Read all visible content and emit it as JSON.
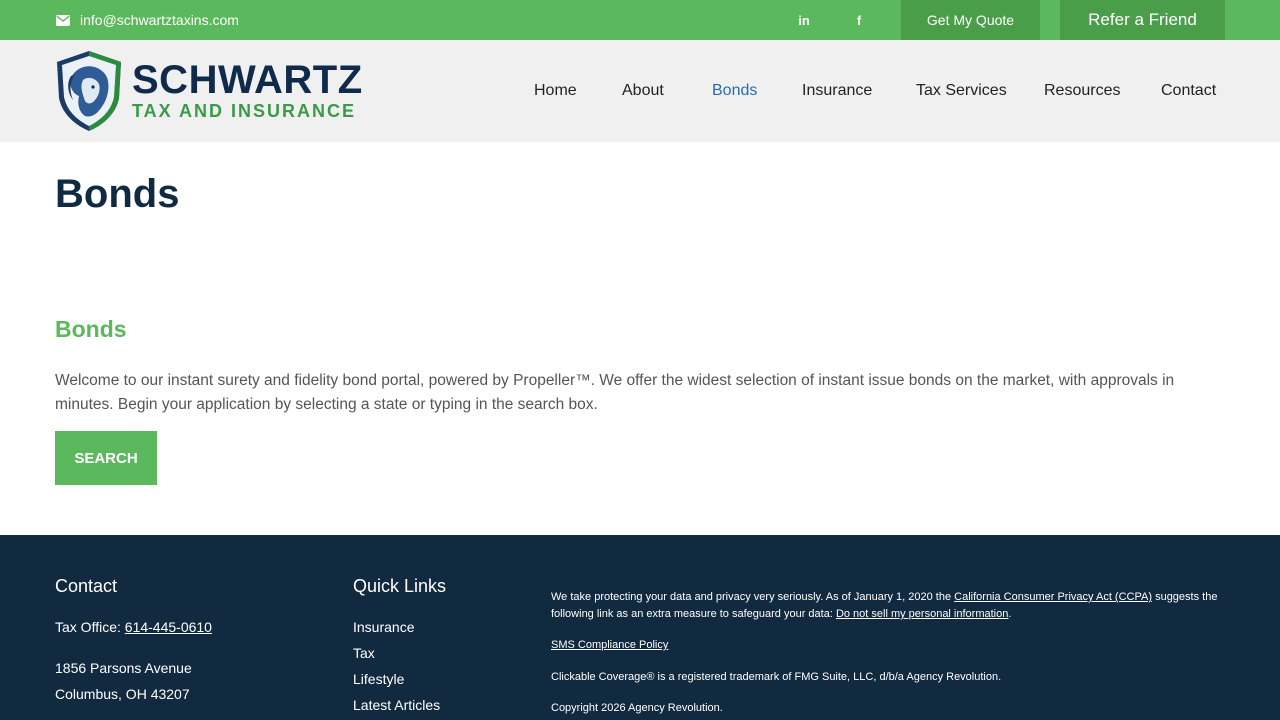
{
  "colors": {
    "green": "#5cb85c",
    "dark_green": "#4a9e4a",
    "navy": "#122a40",
    "title_navy": "#112a44",
    "active_blue": "#2a6bb0"
  },
  "topbar": {
    "email": "info@schwartztaxins.com",
    "linkedin_label": "in",
    "facebook_label": "f",
    "quote_label": "Get My Quote",
    "refer_label": "Refer a Friend"
  },
  "logo": {
    "brand": "SCHWARTZ",
    "tagline": "TAX AND INSURANCE"
  },
  "nav": {
    "items": [
      {
        "label": "Home"
      },
      {
        "label": "About"
      },
      {
        "label": "Bonds"
      },
      {
        "label": "Insurance"
      },
      {
        "label": "Tax Services"
      },
      {
        "label": "Resources"
      },
      {
        "label": "Contact"
      }
    ],
    "active": "Bonds"
  },
  "main": {
    "page_title": "Bonds",
    "section_title": "Bonds",
    "intro": "Welcome to our instant surety and fidelity bond portal, powered by Propeller™. We offer the widest selection of instant issue bonds on the market, with approvals in minutes. Begin your application by selecting a state or typing in the search box.",
    "search_label": "SEARCH"
  },
  "footer": {
    "contact": {
      "title": "Contact",
      "phone_prefix": "Tax Office: ",
      "phone": "614-445-0610",
      "address1": "1856 Parsons Avenue",
      "address2": "Columbus, OH 43207"
    },
    "quick_links": {
      "title": "Quick Links",
      "items": [
        "Insurance",
        "Tax",
        "Lifestyle",
        "Latest Articles"
      ]
    },
    "privacy": {
      "text_a": "We take protecting your data and privacy very seriously. As of January 1, 2020 the ",
      "ccpa_link": "California Consumer Privacy Act (CCPA)",
      "text_b": " suggests the following link as an extra measure to safeguard your data: ",
      "dns_link": "Do not sell my personal information",
      "text_c": "."
    },
    "sms_link": "SMS Compliance Policy",
    "trademark": "Clickable Coverage® is a registered trademark of FMG Suite, LLC, d/b/a Agency Revolution.",
    "copyright": "Copyright 2026 Agency Revolution."
  }
}
